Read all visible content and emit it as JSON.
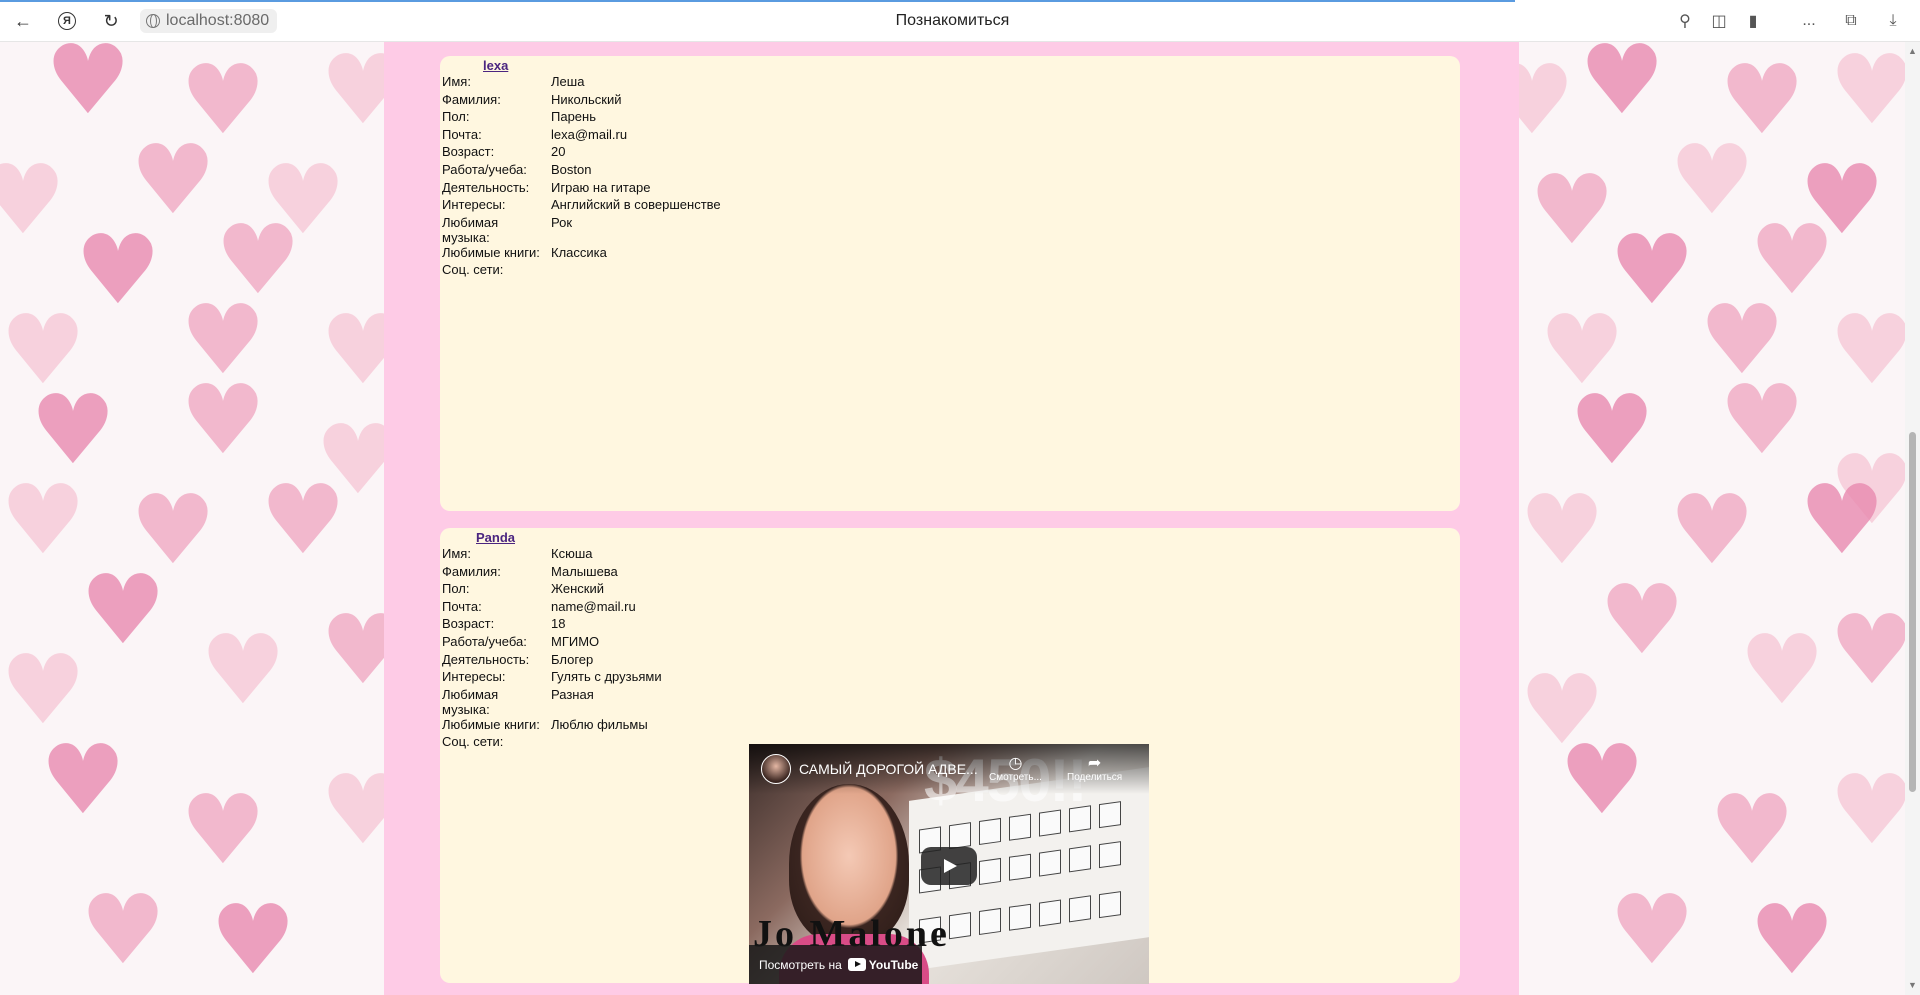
{
  "browser": {
    "address": "localhost:8080",
    "tab_title": "Познакомиться",
    "more_label": "..."
  },
  "profiles": [
    {
      "nickname": "lexa",
      "fields": [
        {
          "label": "Имя:",
          "value": "Леша"
        },
        {
          "label": "Фамилия:",
          "value": "Никольский"
        },
        {
          "label": "Пол:",
          "value": "Парень"
        },
        {
          "label": "Почта:",
          "value": "lexa@mail.ru"
        },
        {
          "label": "Возраст:",
          "value": "20"
        },
        {
          "label": "Работа/учеба:",
          "value": "Boston"
        },
        {
          "label": "Деятельность:",
          "value": "Играю на гитаре"
        },
        {
          "label": "Интересы:",
          "value": "Английский в совершенстве"
        },
        {
          "label": "Любимая музыка:",
          "value": "Рок"
        },
        {
          "label": "Любимые книги:",
          "value": "Классика"
        },
        {
          "label": "Соц. сети:",
          "value": ""
        }
      ]
    },
    {
      "nickname": "Panda",
      "fields": [
        {
          "label": "Имя:",
          "value": "Ксюша"
        },
        {
          "label": "Фамилия:",
          "value": "Малышева"
        },
        {
          "label": "Пол:",
          "value": "Женский"
        },
        {
          "label": "Почта:",
          "value": "name@mail.ru"
        },
        {
          "label": "Возраст:",
          "value": "18"
        },
        {
          "label": "Работа/учеба:",
          "value": "МГИМО"
        },
        {
          "label": "Деятельность:",
          "value": "Блогер"
        },
        {
          "label": "Интересы:",
          "value": "Гулять с друзьями"
        },
        {
          "label": "Любимая музыка:",
          "value": "Разная"
        },
        {
          "label": "Любимые книги:",
          "value": "Люблю фильмы"
        },
        {
          "label": "Соц. сети:",
          "value": ""
        }
      ],
      "video": {
        "title": "САМЫЙ ДОРОГОЙ АДВЕ...",
        "watch_later": "Смотреть...",
        "share": "Поделиться",
        "watch_on": "Посмотреть на",
        "youtube": "YouTube",
        "overlay_price": "$450!!",
        "overlay_brand": "Jo Malone"
      }
    }
  ],
  "colors": {
    "column": "#fecbe6",
    "card": "#fff7e0",
    "link": "#4b2580"
  }
}
